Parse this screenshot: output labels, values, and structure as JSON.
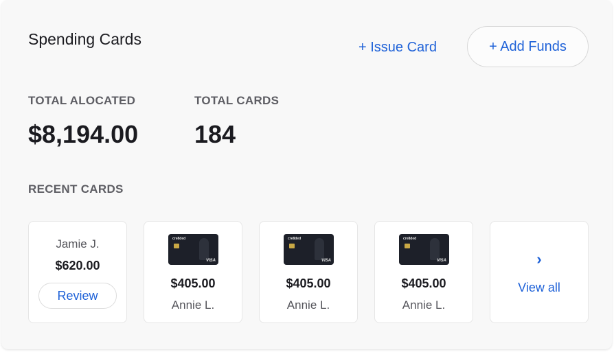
{
  "header": {
    "title": "Spending Cards",
    "issue_card_label": "+ Issue Card",
    "add_funds_label": "+ Add Funds"
  },
  "stats": {
    "total_allocated_label": "TOTAL ALOCATED",
    "total_allocated_value": "$8,194.00",
    "total_cards_label": "TOTAL CARDS",
    "total_cards_value": "184"
  },
  "recent": {
    "label": "RECENT CARDS",
    "pending": {
      "name": "Jamie J.",
      "amount": "$620.00",
      "action_label": "Review"
    },
    "cards": [
      {
        "amount": "$405.00",
        "name": "Annie L.",
        "brand": "cre8ded",
        "network": "VISA"
      },
      {
        "amount": "$405.00",
        "name": "Annie L.",
        "brand": "cre8ded",
        "network": "VISA"
      },
      {
        "amount": "$405.00",
        "name": "Annie L.",
        "brand": "cre8ded",
        "network": "VISA"
      }
    ],
    "view_all": {
      "icon": "chevron-right-icon",
      "label": "View all"
    }
  },
  "colors": {
    "accent": "#1f62d8",
    "text": "#1b1b20",
    "muted": "#5d5d63",
    "card": "#1d2029"
  }
}
